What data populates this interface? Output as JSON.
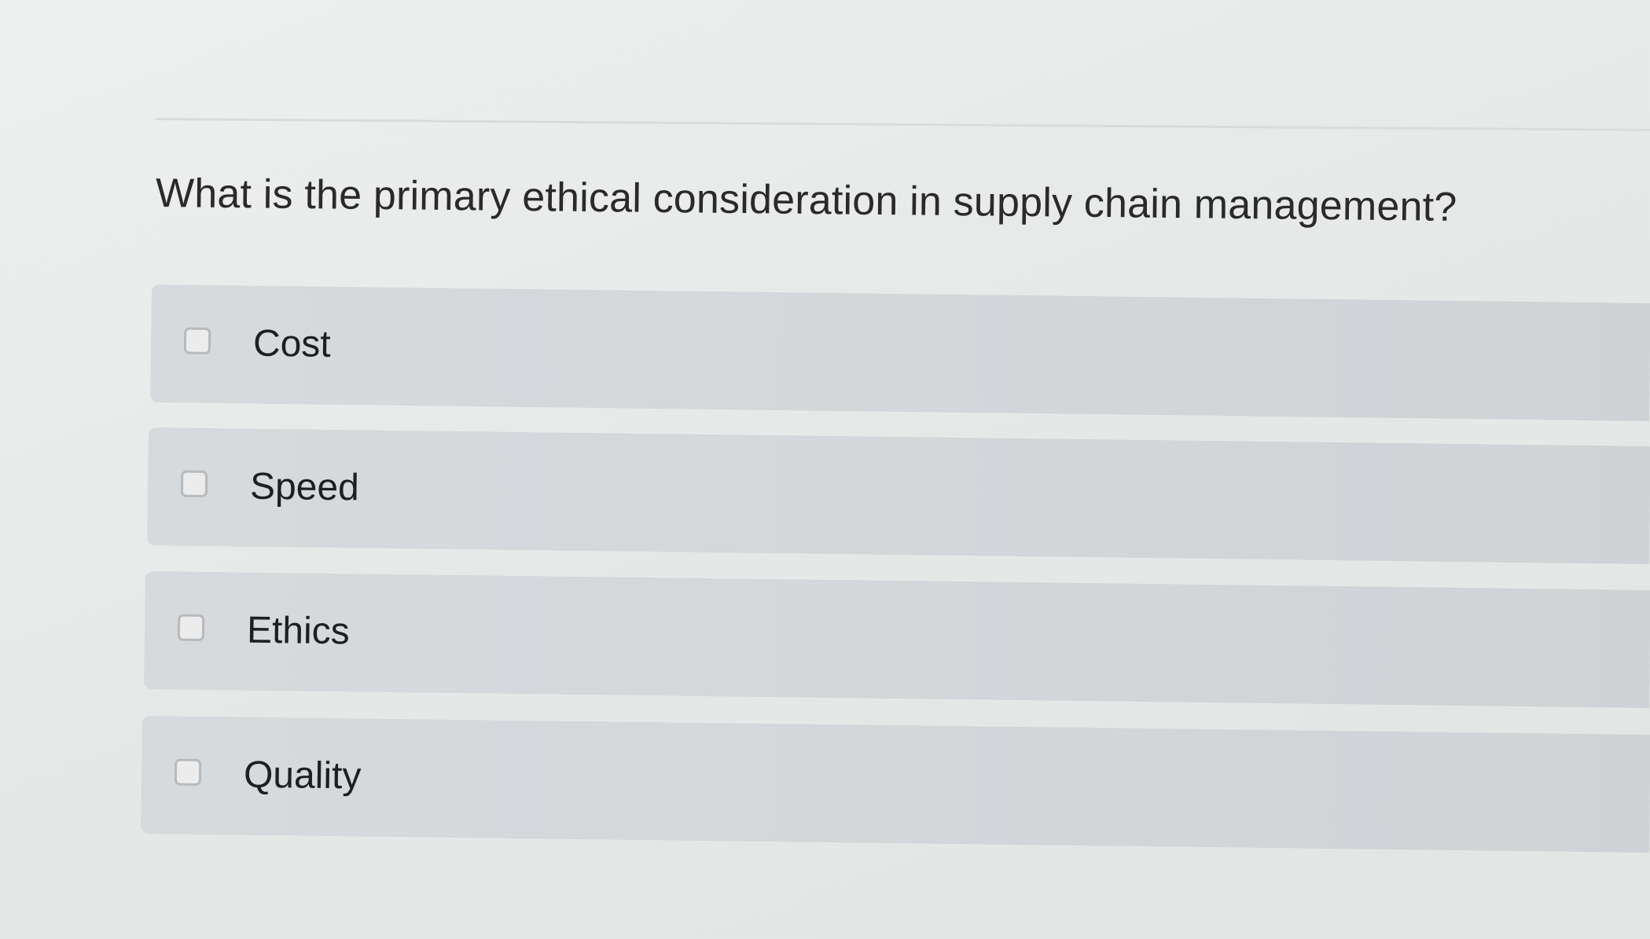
{
  "question": {
    "text": "What is the primary ethical consideration in supply chain management?"
  },
  "options": [
    {
      "label": "Cost",
      "checked": false
    },
    {
      "label": "Speed",
      "checked": false
    },
    {
      "label": "Ethics",
      "checked": false
    },
    {
      "label": "Quality",
      "checked": false
    }
  ],
  "colors": {
    "background": "#e8ebea",
    "option_background": "#d4d8db",
    "text": "#1f1f1f",
    "checkbox_border": "#b7babd"
  }
}
